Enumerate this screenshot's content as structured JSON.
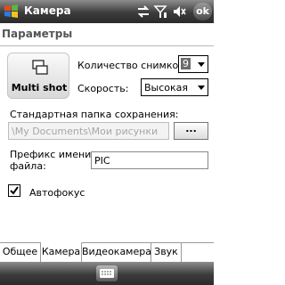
{
  "titlebar": {
    "title": "Камера",
    "ok_label": "ok",
    "icons": [
      "windows-flag-icon",
      "connectivity-icon",
      "signal-icon",
      "volume-muted-icon"
    ]
  },
  "header": {
    "title": "Параметры"
  },
  "multishot": {
    "label": "Multi shot",
    "icon": "multishot-icon"
  },
  "shot_count": {
    "label": "Количество снимков:",
    "value": "9"
  },
  "speed": {
    "label": "Скорость:",
    "value": "Высокая"
  },
  "save_folder": {
    "label": "Стандартная папка сохранения:",
    "value": "\\My Documents\\Мои рисунки",
    "browse_label": "..."
  },
  "file_prefix": {
    "label_line1": "Префикс имени",
    "label_line2": "файла:",
    "value": "PIC"
  },
  "autofocus": {
    "label": "Автофокус",
    "checked": true
  },
  "tabs": [
    {
      "label": "Общее",
      "active": false
    },
    {
      "label": "Камера",
      "active": true
    },
    {
      "label": "Видеокамера",
      "active": false
    },
    {
      "label": "Звук",
      "active": false
    }
  ],
  "menubar": {
    "icon": "keyboard-icon"
  }
}
